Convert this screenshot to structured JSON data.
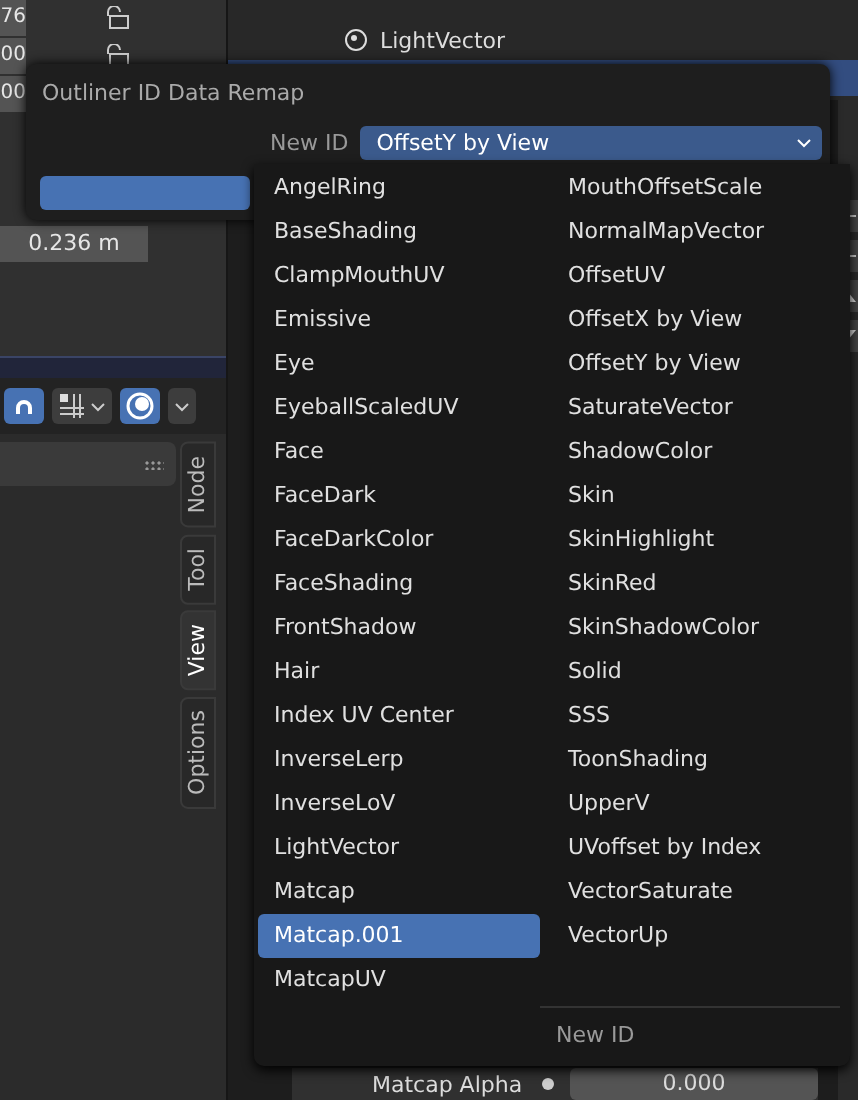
{
  "properties": {
    "values": [
      "76",
      "00",
      "00",
      "0.236 m"
    ]
  },
  "outliner": {
    "items": [
      {
        "label": "LightVector",
        "selected": false
      }
    ]
  },
  "sidebar": {
    "tabs": [
      {
        "label": "Node",
        "selected": false
      },
      {
        "label": "Tool",
        "selected": false
      },
      {
        "label": "View",
        "selected": true
      },
      {
        "label": "Options",
        "selected": false
      }
    ]
  },
  "dialog": {
    "title": "Outliner ID Data Remap",
    "field_label": "New ID",
    "field_value": "OffsetY by View"
  },
  "menu": {
    "columns": [
      [
        {
          "label": "AngelRing",
          "selected": false
        },
        {
          "label": "BaseShading",
          "selected": false
        },
        {
          "label": "ClampMouthUV",
          "selected": false
        },
        {
          "label": "Emissive",
          "selected": false
        },
        {
          "label": "Eye",
          "selected": false
        },
        {
          "label": "EyeballScaledUV",
          "selected": false
        },
        {
          "label": "Face",
          "selected": false
        },
        {
          "label": "FaceDark",
          "selected": false
        },
        {
          "label": "FaceDarkColor",
          "selected": false
        },
        {
          "label": "FaceShading",
          "selected": false
        },
        {
          "label": "FrontShadow",
          "selected": false
        },
        {
          "label": "Hair",
          "selected": false
        },
        {
          "label": "Index UV Center",
          "selected": false
        },
        {
          "label": "InverseLerp",
          "selected": false
        },
        {
          "label": "InverseLoV",
          "selected": false
        },
        {
          "label": "LightVector",
          "selected": false
        },
        {
          "label": "Matcap",
          "selected": false
        },
        {
          "label": "Matcap.001",
          "selected": true
        },
        {
          "label": "MatcapUV",
          "selected": false
        }
      ],
      [
        {
          "label": "MouthOffsetScale",
          "selected": false
        },
        {
          "label": "NormalMapVector",
          "selected": false
        },
        {
          "label": "OffsetUV",
          "selected": false
        },
        {
          "label": "OffsetX by View",
          "selected": false
        },
        {
          "label": "OffsetY by View",
          "selected": false
        },
        {
          "label": "SaturateVector",
          "selected": false
        },
        {
          "label": "ShadowColor",
          "selected": false
        },
        {
          "label": "Skin",
          "selected": false
        },
        {
          "label": "SkinHighlight",
          "selected": false
        },
        {
          "label": "SkinRed",
          "selected": false
        },
        {
          "label": "SkinShadowColor",
          "selected": false
        },
        {
          "label": "Solid",
          "selected": false
        },
        {
          "label": "SSS",
          "selected": false
        },
        {
          "label": "ToonShading",
          "selected": false
        },
        {
          "label": "UpperV",
          "selected": false
        },
        {
          "label": "UVoffset by Index",
          "selected": false
        },
        {
          "label": "VectorSaturate",
          "selected": false
        },
        {
          "label": "VectorUp",
          "selected": false
        }
      ]
    ],
    "footer": "New ID"
  },
  "node_panel": {
    "label": "Matcap Alpha",
    "value": "0.000"
  }
}
